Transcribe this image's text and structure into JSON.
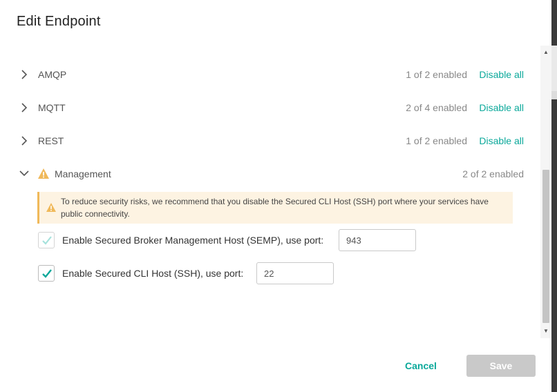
{
  "dialog": {
    "title": "Edit Endpoint"
  },
  "protocols": [
    {
      "name": "AMQP",
      "status": "1 of 2 enabled",
      "action": "Disable all"
    },
    {
      "name": "MQTT",
      "status": "2 of 4 enabled",
      "action": "Disable all"
    },
    {
      "name": "REST",
      "status": "1 of 2 enabled",
      "action": "Disable all"
    }
  ],
  "management": {
    "name": "Management",
    "status": "2 of 2 enabled",
    "warning": "To reduce security risks, we recommend that you disable the Secured CLI Host (SSH) port where your services have public connectivity.",
    "options": [
      {
        "label": "Enable Secured Broker Management Host (SEMP), use port:",
        "port": "943",
        "checked": true,
        "disabled": true
      },
      {
        "label": "Enable Secured CLI Host (SSH), use port:",
        "port": "22",
        "checked": true,
        "disabled": false
      }
    ]
  },
  "footer": {
    "cancel_label": "Cancel",
    "save_label": "Save"
  },
  "colors": {
    "accent": "#0aa89a",
    "warning": "#f0b95a",
    "banner_bg": "#fdf3e2",
    "disabled_button": "#c9c9c9"
  }
}
